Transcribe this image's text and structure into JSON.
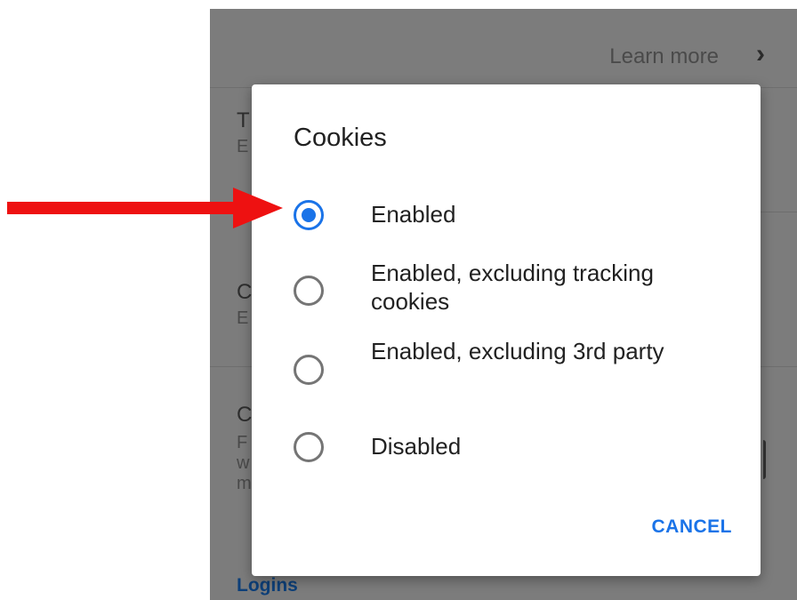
{
  "background": {
    "learn_more": "Learn more",
    "chevron": "›",
    "items": [
      {
        "title": "T",
        "subtitle": "E"
      },
      {
        "title": "C",
        "subtitle": "E"
      },
      {
        "title": "C",
        "subtitle_lines": [
          "F",
          "w",
          "m"
        ]
      }
    ],
    "logins_label": "Logins"
  },
  "dialog": {
    "title": "Cookies",
    "options": [
      {
        "label": "Enabled",
        "selected": true
      },
      {
        "label": "Enabled, excluding tracking cookies",
        "selected": false
      },
      {
        "label": "Enabled, excluding 3rd party",
        "selected": false
      },
      {
        "label": "Disabled",
        "selected": false
      }
    ],
    "cancel_label": "CANCEL"
  },
  "colors": {
    "accent": "#1a73e8",
    "annotation_arrow": "#ee1111",
    "scrim": "#7c7c7c"
  }
}
